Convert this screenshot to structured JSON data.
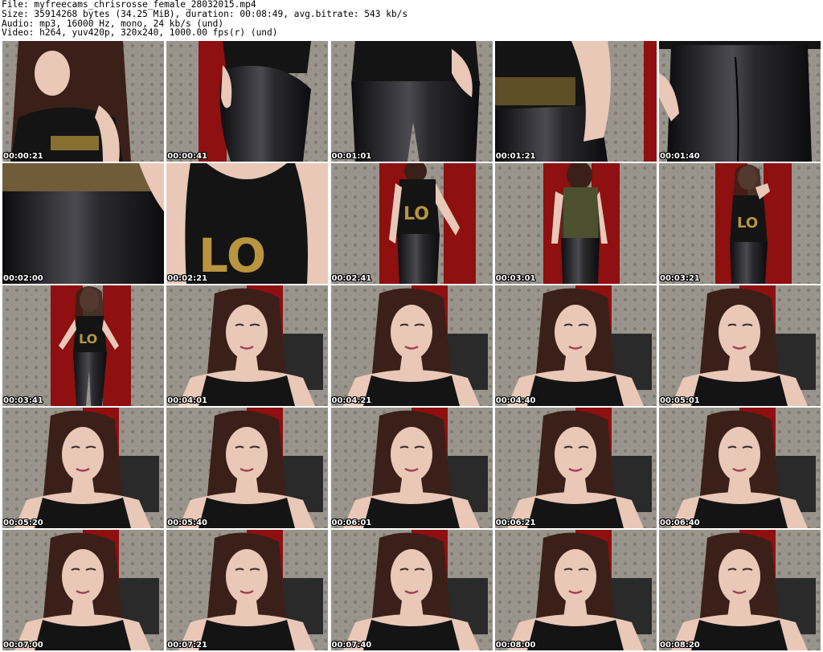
{
  "header": {
    "lines": [
      "File: myfreecams_chrisrosse_female_28032015.mp4",
      "Size: 35914268 bytes (34.25 MiB), duration: 00:08:49, avg.bitrate: 543 kb/s",
      "Audio: mp3, 16000 Hz, mono, 24 kb/s (und)",
      "Video: h264, yuv420p, 320x240, 1000.00 fps(r) (und)"
    ]
  },
  "colors": {
    "curtain_red": "#8e1010",
    "wallpaper_gray": "#9a958c",
    "leggings_black": "#1c1c1e",
    "top_black": "#141414",
    "skin": "#e9c8b8",
    "hair_brown": "#3a2018",
    "sequin_gold": "#b8953e"
  },
  "thumbnails": [
    {
      "timestamp": "00:00:21",
      "scene": "closeup-bend"
    },
    {
      "timestamp": "00:00:41",
      "scene": "leggings-side"
    },
    {
      "timestamp": "00:01:01",
      "scene": "leggings-front"
    },
    {
      "timestamp": "00:01:21",
      "scene": "arm-hip"
    },
    {
      "timestamp": "00:01:40",
      "scene": "leggings-back"
    },
    {
      "timestamp": "00:02:00",
      "scene": "leggings-waist"
    },
    {
      "timestamp": "00:02:21",
      "scene": "top-love"
    },
    {
      "timestamp": "00:02:41",
      "scene": "standing-love"
    },
    {
      "timestamp": "00:03:01",
      "scene": "standing-back"
    },
    {
      "timestamp": "00:03:21",
      "scene": "standing-pose"
    },
    {
      "timestamp": "00:03:41",
      "scene": "full-body"
    },
    {
      "timestamp": "00:04:01",
      "scene": "portrait"
    },
    {
      "timestamp": "00:04:21",
      "scene": "portrait"
    },
    {
      "timestamp": "00:04:40",
      "scene": "portrait"
    },
    {
      "timestamp": "00:05:01",
      "scene": "portrait"
    },
    {
      "timestamp": "00:05:20",
      "scene": "portrait"
    },
    {
      "timestamp": "00:05:40",
      "scene": "portrait"
    },
    {
      "timestamp": "00:06:01",
      "scene": "portrait"
    },
    {
      "timestamp": "00:06:21",
      "scene": "portrait"
    },
    {
      "timestamp": "00:06:40",
      "scene": "portrait"
    },
    {
      "timestamp": "00:07:00",
      "scene": "portrait"
    },
    {
      "timestamp": "00:07:21",
      "scene": "portrait"
    },
    {
      "timestamp": "00:07:40",
      "scene": "portrait"
    },
    {
      "timestamp": "00:08:00",
      "scene": "portrait"
    },
    {
      "timestamp": "00:08:20",
      "scene": "portrait"
    }
  ]
}
